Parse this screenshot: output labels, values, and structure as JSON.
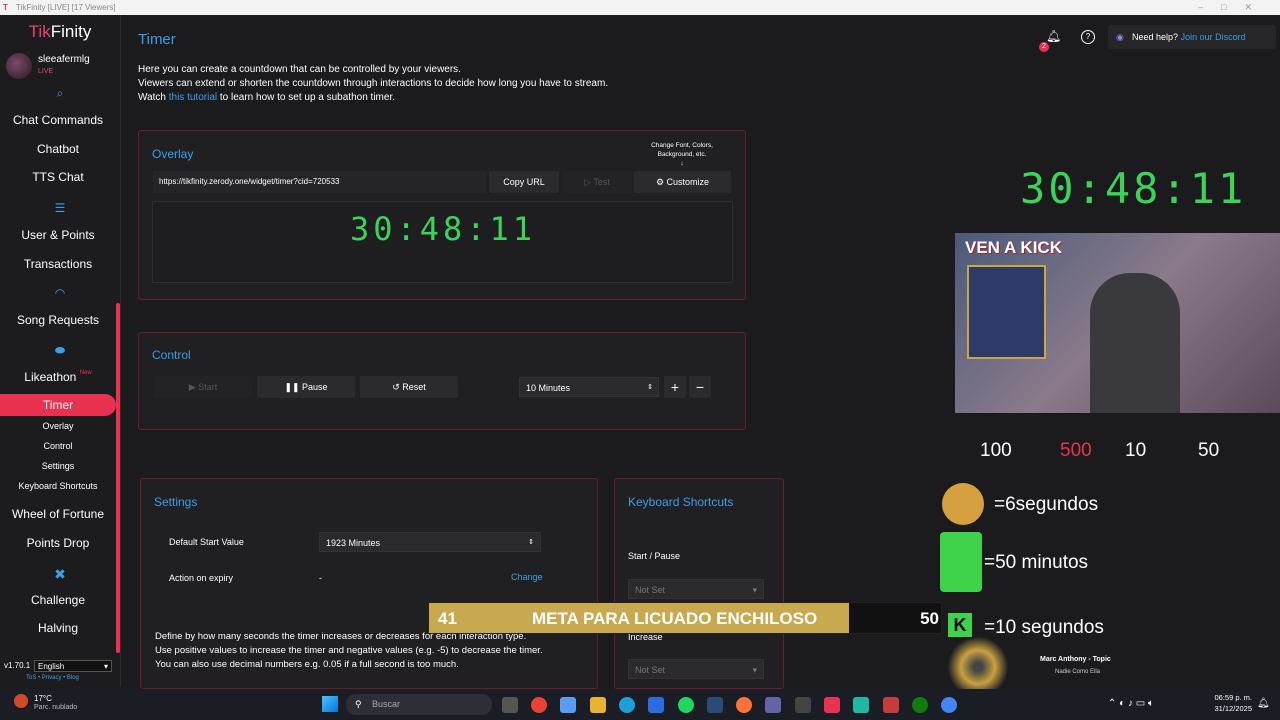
{
  "window": {
    "title": "TikFinity [LIVE] [17 Viewers]"
  },
  "sidebar": {
    "brand_tik": "Tik",
    "brand_finity": "Finity",
    "username": "sleeafermlg",
    "live": "LIVE",
    "items": [
      "Chat Commands",
      "Chatbot",
      "TTS Chat",
      "User & Points",
      "Transactions",
      "Song Requests",
      "Likeathon",
      "Timer",
      "Wheel of Fortune",
      "Points Drop",
      "Challenge",
      "Halving"
    ],
    "new_badge": "New",
    "timer_sub": [
      "Overlay",
      "Control",
      "Settings",
      "Keyboard Shortcuts"
    ],
    "version": "v1.70.1",
    "language": "English",
    "footer": "ToS • Privacy • Blog"
  },
  "header": {
    "need_help": "Need help?",
    "discord": "Join our Discord",
    "bell_badge": "2"
  },
  "page": {
    "title": "Timer",
    "desc1": "Here you can create a countdown that can be controlled by your viewers.",
    "desc2": "Viewers can extend or shorten the countdown through interactions to decide how long you have to stream.",
    "desc3_pre": "Watch ",
    "desc3_link": "this tutorial",
    "desc3_post": " to learn how to set up a subathon timer."
  },
  "overlay": {
    "title": "Overlay",
    "url": "https://tikfinity.zerody.one/widget/timer?cid=720533",
    "copy": "Copy URL",
    "test": "Test",
    "customize": "Customize",
    "hint": "Change Font, Colors, Background, etc.",
    "time": "30:48:11"
  },
  "control": {
    "title": "Control",
    "start": "Start",
    "pause": "Pause",
    "reset": "Reset",
    "amount": "10 Minutes"
  },
  "settings": {
    "title": "Settings",
    "default_label": "Default Start Value",
    "default_value": "1923 Minutes",
    "expiry_label": "Action on expiry",
    "expiry_value": "-",
    "change": "Change",
    "define1": "Define by how many seconds the timer increases or decreases for each interaction type.",
    "define2": "Use positive values to increase the timer and negative values (e.g. -5) to decrease the timer.",
    "define3": "You can also use decimal numbers e.g. 0.05 if a full second is too much."
  },
  "shortcuts": {
    "title": "Keyboard Shortcuts",
    "start_pause": "Start / Pause",
    "not_set": "Not Set",
    "increase": "Increase"
  },
  "stream": {
    "timer": "30:48:11",
    "cam_text": "VEN A KICK",
    "rate1": "=6segundos",
    "rate2": "=50 minutos",
    "rate3": "=10 segundos",
    "num100": "100",
    "num500": "500",
    "num10": "10",
    "num50": "50",
    "goal_left": "41",
    "goal_text": "META PARA LICUADO ENCHILOSO",
    "goal_right": "50",
    "goal_progress": 0.82,
    "song": "Marc Anthony - Topic",
    "song_sub": "Nadie Como Ella"
  },
  "taskbar": {
    "weather": "17°C",
    "weather_sub": "Parc. nublado",
    "search": "Buscar",
    "time": "06:59 p. m.",
    "date": "31/12/2025"
  }
}
